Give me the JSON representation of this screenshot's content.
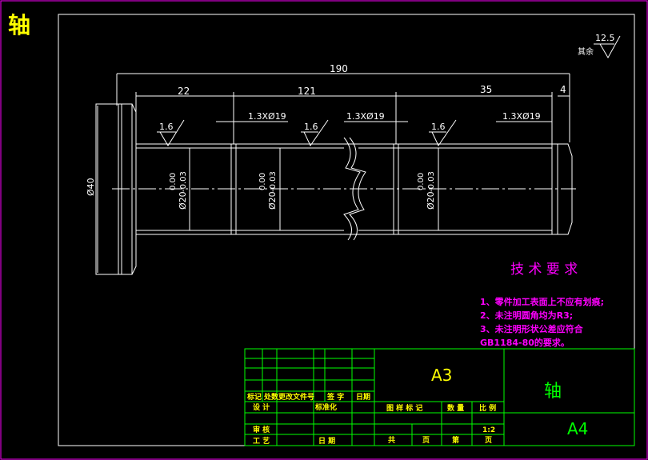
{
  "window_title": "轴",
  "drawing": {
    "dimensions": {
      "overall_length": "190",
      "seg1": "22",
      "seg2": "121",
      "seg3": "35",
      "seg4": "4",
      "groove1": "1.3XØ19",
      "groove2": "1.3XØ19",
      "groove3": "1.3XØ19",
      "dia_head": "Ø40",
      "dia_shaft1": "Ø20",
      "dia_shaft2": "Ø20",
      "dia_shaft3": "Ø20",
      "tol_upper": "0.00",
      "tol_lower": "-0.03"
    },
    "roughness": {
      "rest_label": "其余",
      "rest_value": "12.5",
      "r1": "1.6",
      "r2": "1.6",
      "r3": "1.6"
    }
  },
  "tech_requirements": {
    "title": "技 术 要 求",
    "items": [
      "1、零件加工表面上不应有划痕;",
      "2、未注明圆角均为R3;",
      "3、未注明形状公差应符合",
      "GB1184-80的要求。"
    ]
  },
  "title_block": {
    "material": "A3",
    "part_name": "轴",
    "sheet_size": "A4",
    "scale": "1:2",
    "labels": {
      "mark": "标记",
      "count": "处数",
      "change_doc": "更改文件号",
      "sign": "签 字",
      "date": "日期",
      "design": "设 计",
      "standardize": "标准化",
      "review": "审 核",
      "process": "工 艺",
      "date2": "日 期",
      "stage_mark": "图 样 标 记",
      "quantity": "数 量",
      "ratio": "比 例",
      "total": "共",
      "page1": "页",
      "nth": "第",
      "page2": "页"
    }
  },
  "colors": {
    "background": "#000000",
    "outline": "#ffffff",
    "border": "#ff00ff",
    "dimension": "#ffffff",
    "title_block": "#00ff00",
    "text_yellow": "#ffff00",
    "requirements": "#ff00ff"
  }
}
